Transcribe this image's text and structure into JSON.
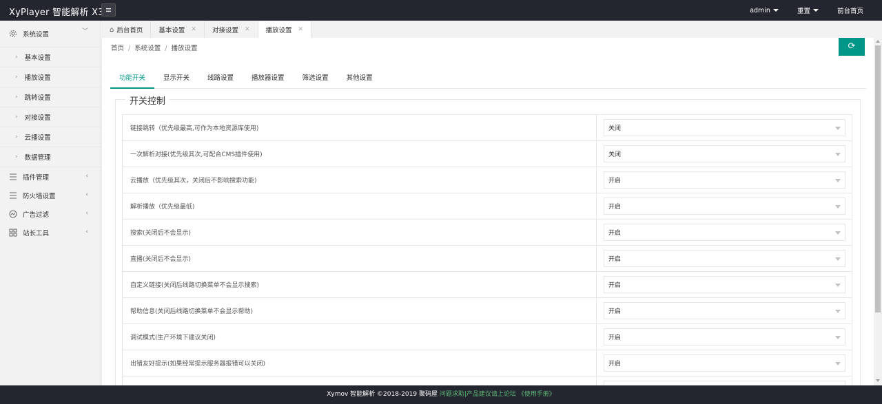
{
  "header": {
    "title": "XyPlayer 智能解析 X3",
    "menu_toggle_icon": "hamburger-icon",
    "user": "admin",
    "reset": "重置",
    "frontend": "前台首页"
  },
  "sidebar": {
    "system": "系统设置",
    "children": [
      "基本设置",
      "播放设置",
      "跳转设置",
      "对接设置",
      "云播设置",
      "数据管理"
    ],
    "groups": [
      "插件管理",
      "防火墙设置",
      "广告过滤",
      "站长工具"
    ]
  },
  "tabs": {
    "home": "后台首页",
    "items": [
      "基本设置",
      "对接设置",
      "播放设置"
    ]
  },
  "breadcrumb": [
    "首页",
    "系统设置",
    "播放设置"
  ],
  "subtabs": [
    "功能开关",
    "显示开关",
    "线路设置",
    "播放器设置",
    "筛选设置",
    "其他设置"
  ],
  "section_title": "开关控制",
  "rows": [
    {
      "label": "链接跳转（优先级最高,可作为本地资源库使用)",
      "value": "关闭"
    },
    {
      "label": "一次解析对接(优先级其次,可配合CMS插件使用)",
      "value": "关闭"
    },
    {
      "label": "云播放（优先级其次，关闭后不影响搜索功能)",
      "value": "开启"
    },
    {
      "label": "解析播放（优先级最低)",
      "value": "开启"
    },
    {
      "label": "搜索(关闭后不会显示)",
      "value": "开启"
    },
    {
      "label": "直播(关闭后不会显示)",
      "value": "开启"
    },
    {
      "label": "自定义链接(关闭后线路切换菜单不会显示搜索)",
      "value": "开启"
    },
    {
      "label": "帮助信息(关闭后线路切换菜单不会显示帮助)",
      "value": "开启"
    },
    {
      "label": "调试模式(生产环境下建议关闭)",
      "value": "开启"
    },
    {
      "label": "出错友好提示(如果经常提示服务器报错可以关闭)",
      "value": "开启"
    },
    {
      "label": "",
      "value": ""
    }
  ],
  "footer": {
    "text": "Xymov 智能解析 ©2018-2019",
    "brand": "聚码屋",
    "link1": "问题求助|产品建议请上论坛",
    "link2": "《使用手册》"
  },
  "colors": {
    "accent": "#009688",
    "header_bg": "#23262e",
    "footer_link": "#5fb878"
  }
}
